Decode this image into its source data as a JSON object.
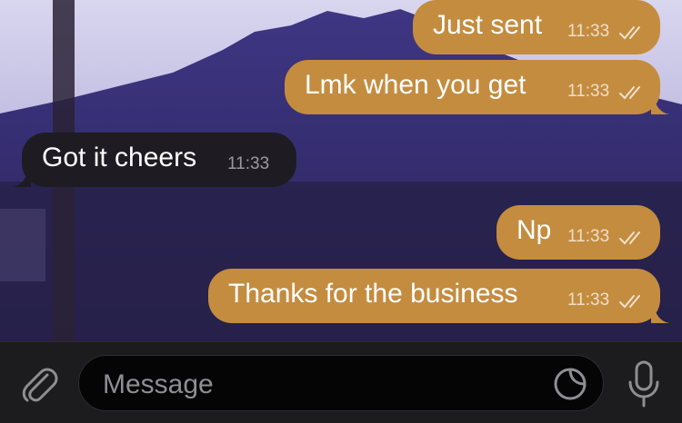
{
  "messages": [
    {
      "direction": "out",
      "text": "Just sent",
      "time": "11:33",
      "status": "read"
    },
    {
      "direction": "out",
      "text": "Lmk when you get",
      "time": "11:33",
      "status": "read"
    },
    {
      "direction": "in",
      "text": "Got it cheers",
      "time": "11:33"
    },
    {
      "direction": "out",
      "text": "Np",
      "time": "11:33",
      "status": "read"
    },
    {
      "direction": "out",
      "text": "Thanks for the business",
      "time": "11:33",
      "status": "read"
    }
  ],
  "composer": {
    "placeholder": "Message",
    "attach_icon": "paperclip-icon",
    "sticker_icon": "sticker-icon",
    "mic_icon": "microphone-icon"
  },
  "colors": {
    "outgoing_bubble": "#c48c3f",
    "incoming_bubble": "#1e1c22",
    "input_bar": "#1c1c1e"
  }
}
